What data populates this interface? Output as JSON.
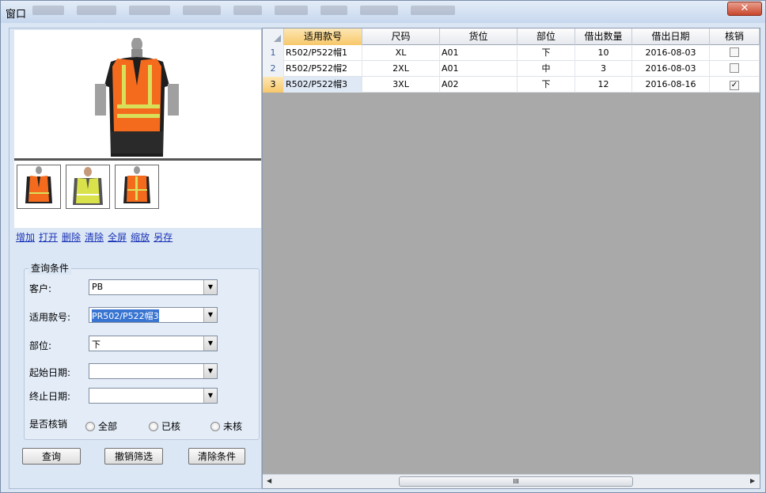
{
  "window": {
    "title": "窗口",
    "close_label": "✕"
  },
  "links": [
    "增加",
    "打开",
    "删除",
    "清除",
    "全屏",
    "缩放",
    "另存"
  ],
  "query": {
    "legend": "查询条件",
    "customer_label": "客户:",
    "customer_value": "PB",
    "style_label": "适用款号:",
    "style_value": "PR502/P522帽3",
    "part_label": "部位:",
    "part_value": "下",
    "start_label": "起始日期:",
    "start_value": "",
    "end_label": "终止日期:",
    "end_value": "",
    "writeoff_label": "是否核销",
    "radios": [
      "全部",
      "已核",
      "未核"
    ],
    "buttons": {
      "query": "查询",
      "cancel_filter": "撤销筛选",
      "clear": "清除条件"
    }
  },
  "grid": {
    "headers": [
      "适用款号",
      "尺码",
      "货位",
      "部位",
      "借出数量",
      "借出日期",
      "核销"
    ],
    "rows": [
      {
        "num": "1",
        "style": "R502/P522帽1",
        "size": "XL",
        "loc": "A01",
        "part": "下",
        "qty": "10",
        "date": "2016-08-03",
        "checked": false
      },
      {
        "num": "2",
        "style": "R502/P522帽2",
        "size": "2XL",
        "loc": "A01",
        "part": "中",
        "qty": "3",
        "date": "2016-08-03",
        "checked": false
      },
      {
        "num": "3",
        "style": "R502/P522帽3",
        "size": "3XL",
        "loc": "A02",
        "part": "下",
        "qty": "12",
        "date": "2016-08-16",
        "checked": true
      }
    ],
    "scroll_grip": "III",
    "active_row": 3
  },
  "icons": {
    "dropdown": "chevron-down-icon",
    "check": "checkmark-icon"
  },
  "colors": {
    "link": "#1a33b5",
    "selection": "#3874d1",
    "header_sorted": "#f7c86a",
    "grid_bg": "#a9a9a9"
  }
}
